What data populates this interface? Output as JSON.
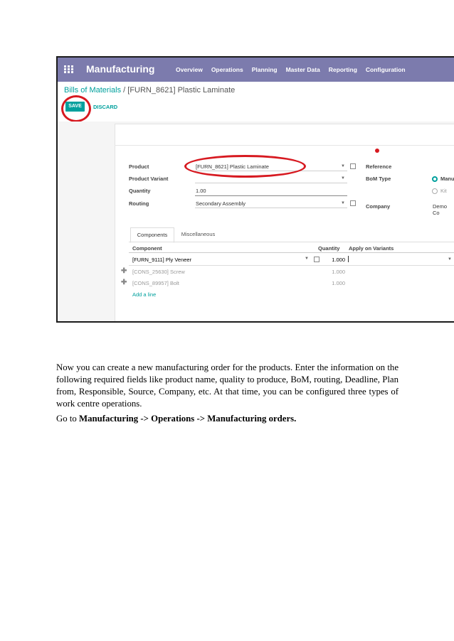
{
  "screenshot": {
    "app_title": "Manufacturing",
    "menu": [
      "Overview",
      "Operations",
      "Planning",
      "Master Data",
      "Reporting",
      "Configuration"
    ],
    "breadcrumb": {
      "parent": "Bills of Materials",
      "separator": "/",
      "current": "[FURN_8621] Plastic Laminate"
    },
    "buttons": {
      "save": "SAVE",
      "discard": "DISCARD"
    },
    "form": {
      "product_label": "Product",
      "product_value": "[FURN_8621] Plastic Laminate",
      "variant_label": "Product Variant",
      "variant_value": "",
      "quantity_label": "Quantity",
      "quantity_value": "1.00",
      "routing_label": "Routing",
      "routing_value": "Secondary Assembly",
      "reference_label": "Reference",
      "bom_type_label": "BoM Type",
      "bom_type_options": [
        "Manu",
        "Kit"
      ],
      "company_label": "Company",
      "company_value": "Demo Co"
    },
    "tabs": [
      "Components",
      "Miscellaneous"
    ],
    "table": {
      "headers": [
        "Component",
        "Quantity",
        "Apply on Variants"
      ],
      "rows": [
        {
          "component": "[FURN_9111] Ply Veneer",
          "quantity": "1.000"
        },
        {
          "component": "[CONS_25630] Screw",
          "quantity": "1.000"
        },
        {
          "component": "[CONS_89957] Bolt",
          "quantity": "1.000"
        }
      ],
      "add_line": "Add a line"
    },
    "colors": {
      "brand": "#7c7bad",
      "accent": "#00a09d",
      "annotation": "#d71920"
    }
  },
  "document": {
    "paragraph": "Now you can create a new manufacturing order for the products. Enter the information on the following required fields like product name, quality to produce, BoM, routing, Deadline, Plan from, Responsible, Source, Company, etc. At that time, you can be configured three types of work centre operations.",
    "goto_prefix": "Go to",
    "goto_path": "Manufacturing -> Operations -> Manufacturing orders."
  }
}
